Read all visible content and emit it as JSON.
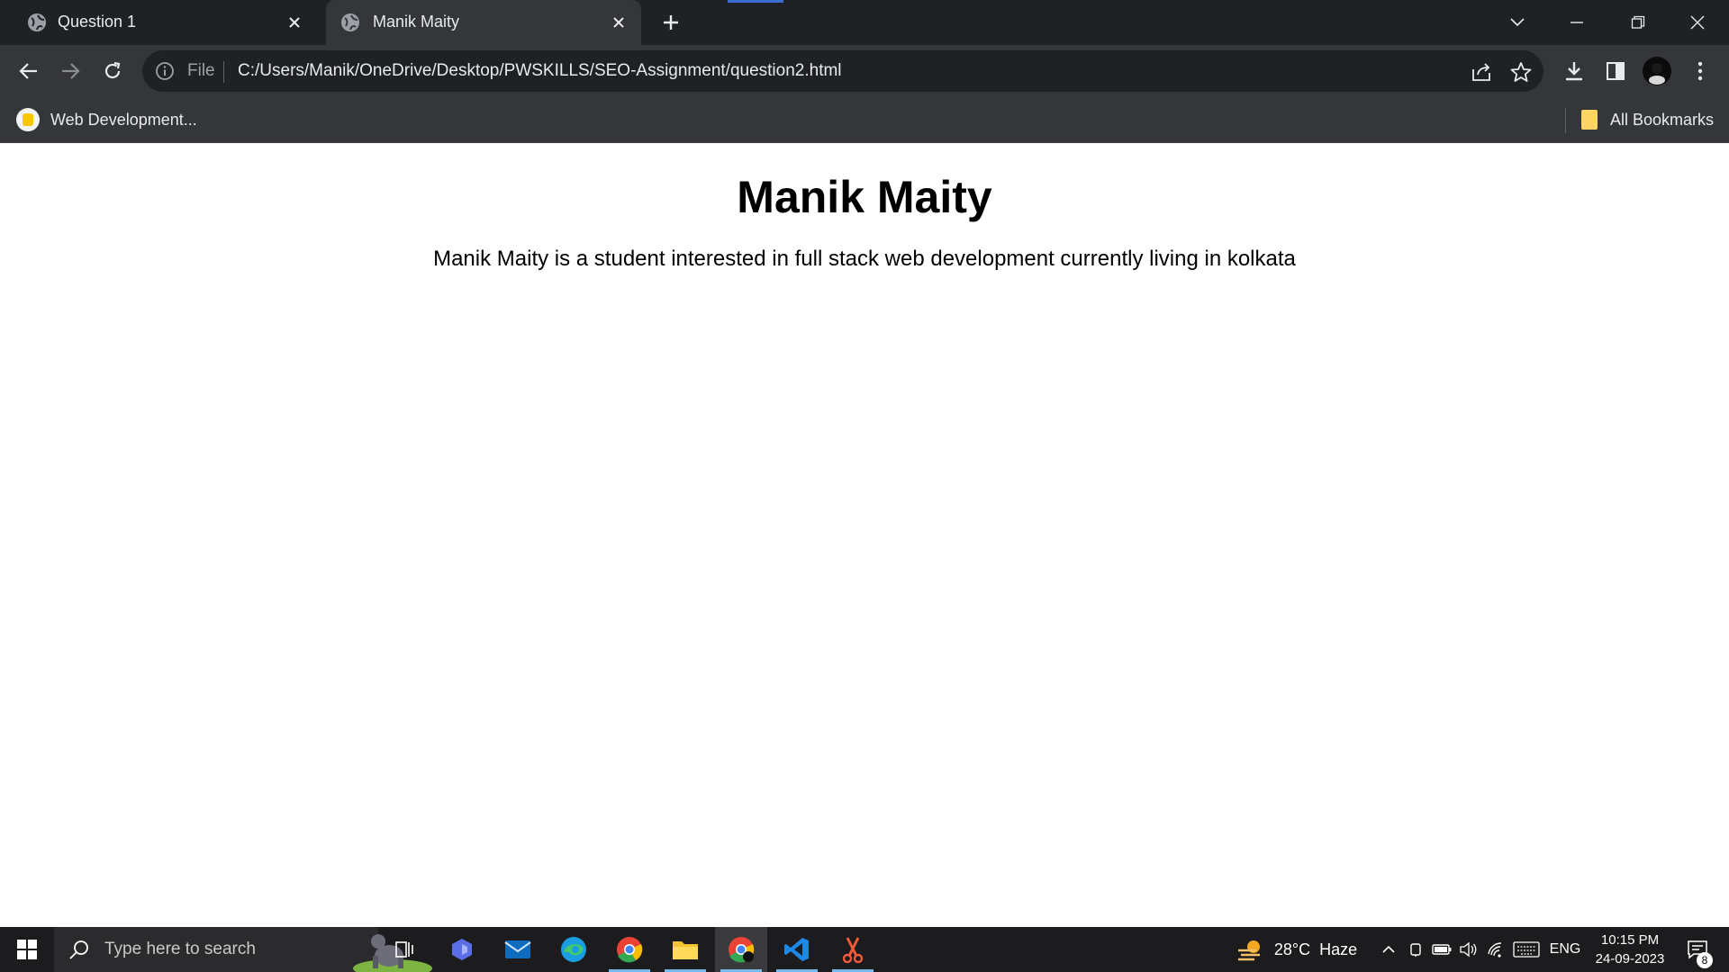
{
  "browser": {
    "tabs": [
      {
        "title": "Question 1",
        "active": false
      },
      {
        "title": "Manik Maity",
        "active": true
      }
    ],
    "address_bar": {
      "scheme_label": "File",
      "url": "C:/Users/Manik/OneDrive/Desktop/PWSKILLS/SEO-Assignment/question2.html"
    },
    "bookmarks": {
      "left_item": "Web Development...",
      "right_item": "All Bookmarks"
    }
  },
  "page": {
    "heading": "Manik Maity",
    "paragraph": "Manik Maity is a student interested in full stack web development currently living in kolkata"
  },
  "taskbar": {
    "search_placeholder": "Type here to search",
    "weather": "28°C  Haze",
    "language": "ENG",
    "time": "10:15 PM",
    "date": "24-09-2023",
    "notification_count": "8",
    "apps": [
      "task-view",
      "copilot",
      "mail",
      "edge",
      "chrome",
      "file-explorer",
      "chrome-active",
      "vscode",
      "snipping-tool"
    ]
  },
  "colors": {
    "tabstrip_bg": "#202124",
    "toolbar_bg": "#35363a",
    "page_bg": "#ffffff",
    "taskbar_bg": "#1c1c1e",
    "accent_underline": "#76b9ed"
  }
}
